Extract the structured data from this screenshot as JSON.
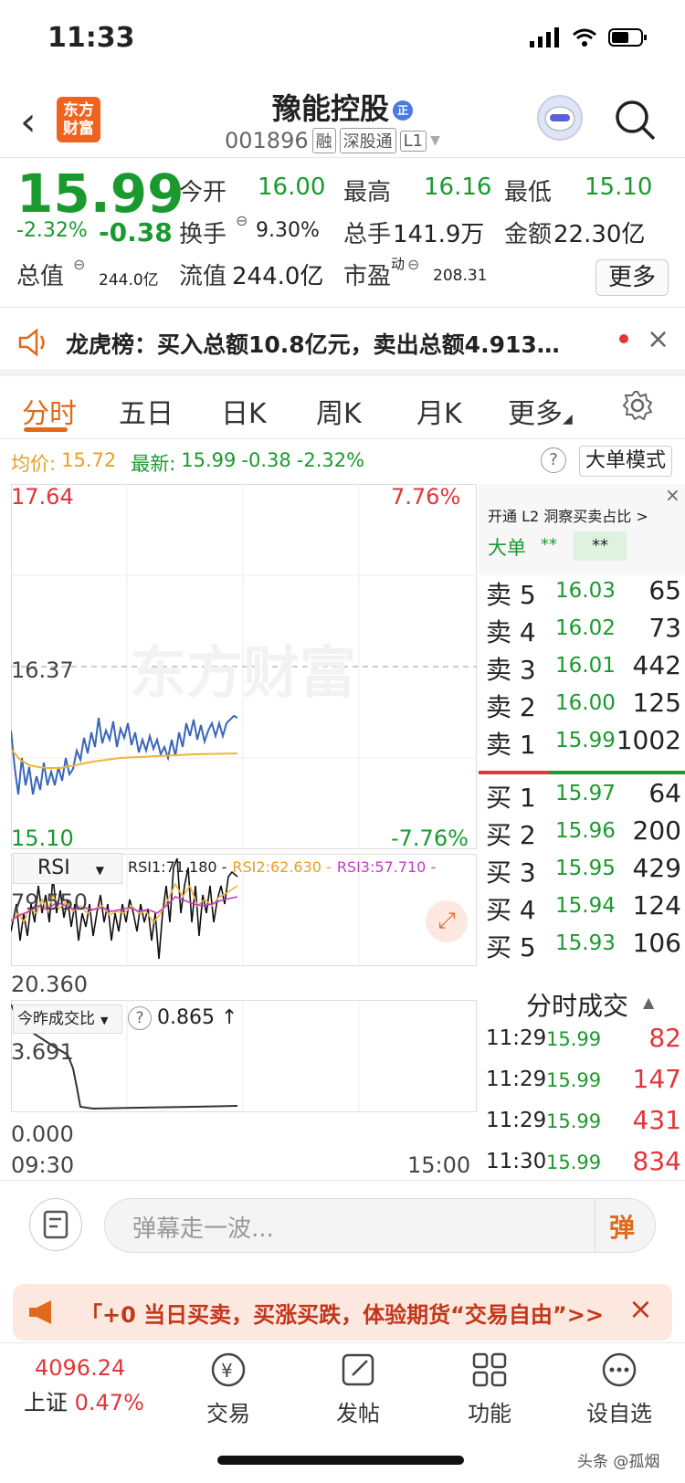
{
  "status": {
    "time": "11:33"
  },
  "header": {
    "logo_line1": "东方",
    "logo_line2": "财富",
    "stock_name": "豫能控股",
    "name_badge": "正",
    "stock_code": "001896",
    "tags": [
      "融",
      "深股通",
      "L1"
    ]
  },
  "quote": {
    "price": "15.99",
    "change_pct": "-2.32%",
    "change": "-0.38",
    "open_label": "今开",
    "open": "16.00",
    "high_label": "最高",
    "high": "16.16",
    "low_label": "最低",
    "low": "15.10",
    "turnover_label": "换手",
    "turnover": "9.30%",
    "volume_label": "总手",
    "volume": "141.9万",
    "amount_label": "金额",
    "amount": "22.30亿",
    "mktcap_label": "总值",
    "mktcap": "244.0亿",
    "float_label": "流值",
    "float": "244.0亿",
    "pe_label": "市盈",
    "pe_sup": "动",
    "pe": "208.31",
    "more": "更多"
  },
  "notice": {
    "text": "龙虎榜：买入总额10.8亿元，卖出总额4.913…"
  },
  "tabs": [
    "分时",
    "五日",
    "日K",
    "周K",
    "月K",
    "更多"
  ],
  "legend": {
    "avg_label": "均价:",
    "avg": "15.72",
    "latest_label": "最新:",
    "latest": "15.99",
    "chg": "-0.38",
    "chg_pct": "-2.32%",
    "mode_btn": "大单模式"
  },
  "intraday": {
    "y_top": "17.64",
    "y_mid": "16.37",
    "y_bot": "15.10",
    "pct_top": "7.76%",
    "pct_bot": "-7.76%",
    "watermark": "东方财富",
    "time_start": "09:30",
    "time_end": "15:00"
  },
  "rsi": {
    "select": "RSI",
    "rsi1": "RSI1:71.180 -",
    "rsi2": "RSI2:62.630 -",
    "rsi3": "RSI3:57.710 -",
    "y_top": "79.550",
    "y_bot": "20.360"
  },
  "vol_ratio": {
    "select": "今昨成交比",
    "value": "0.865 ↑",
    "y_top": "3.691",
    "y_bot": "0.000"
  },
  "l2": {
    "title": "开通 L2 洞察买卖占比 >",
    "big_label": "大单",
    "v1": "**",
    "v2": "**"
  },
  "asks": [
    {
      "label": "卖 5",
      "price": "16.03",
      "vol": "65"
    },
    {
      "label": "卖 4",
      "price": "16.02",
      "vol": "73"
    },
    {
      "label": "卖 3",
      "price": "16.01",
      "vol": "442"
    },
    {
      "label": "卖 2",
      "price": "16.00",
      "vol": "125"
    },
    {
      "label": "卖 1",
      "price": "15.99",
      "vol": "1002"
    }
  ],
  "bids": [
    {
      "label": "买 1",
      "price": "15.97",
      "vol": "64"
    },
    {
      "label": "买 2",
      "price": "15.96",
      "vol": "200"
    },
    {
      "label": "买 3",
      "price": "15.95",
      "vol": "429"
    },
    {
      "label": "买 4",
      "price": "15.94",
      "vol": "124"
    },
    {
      "label": "买 5",
      "price": "15.93",
      "vol": "106"
    }
  ],
  "trades_title": "分时成交",
  "trades": [
    {
      "time": "11:29",
      "price": "15.99",
      "vol": "82"
    },
    {
      "time": "11:29",
      "price": "15.99",
      "vol": "147"
    },
    {
      "time": "11:29",
      "price": "15.99",
      "vol": "431"
    },
    {
      "time": "11:30",
      "price": "15.99",
      "vol": "834"
    }
  ],
  "danmu": {
    "placeholder": "弹幕走一波...",
    "send": "弹"
  },
  "ad": {
    "text": "「+0 当日买卖，买涨买跌，体验期货“交易自由”>>"
  },
  "nav": {
    "index_value": "4096.24",
    "index_name": "上证",
    "index_pct": "0.47%",
    "items": [
      "交易",
      "发帖",
      "功能",
      "设自选"
    ]
  },
  "watermark_footer": "头条 @孤烟",
  "colors": {
    "up": "#e2353a",
    "down": "#1a9a2e",
    "accent": "#e06a1b",
    "price_line": "#3a66b8",
    "avg_line": "#f0b43a"
  }
}
